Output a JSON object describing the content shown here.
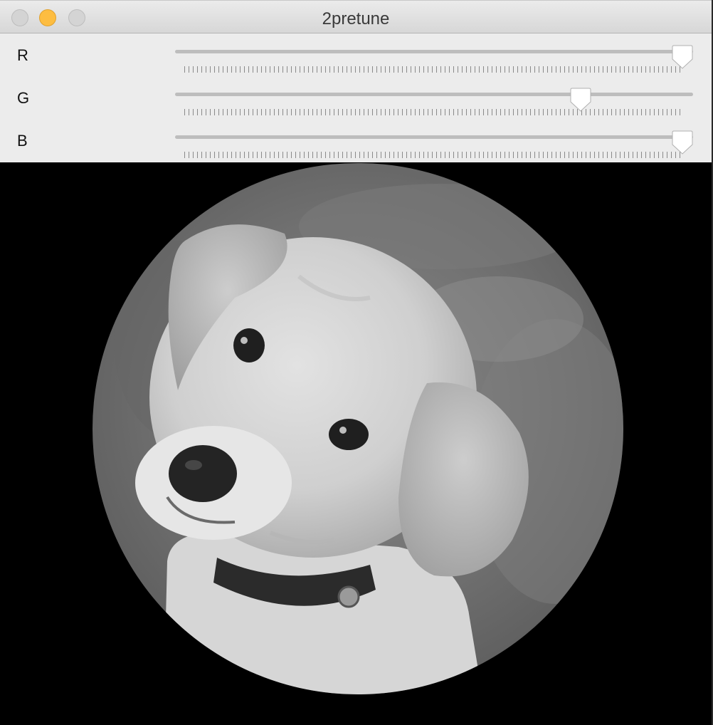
{
  "window": {
    "title": "2pretune"
  },
  "sliders": [
    {
      "label": "R",
      "value": 1.0
    },
    {
      "label": "G",
      "value": 0.795
    },
    {
      "label": "B",
      "value": 1.0
    }
  ],
  "icons": {
    "close": "close-icon",
    "minimize": "minimize-icon",
    "zoom": "zoom-icon"
  },
  "colors": {
    "minimize": "#fdbd41",
    "panel": "#ececec",
    "background": "#000000"
  }
}
